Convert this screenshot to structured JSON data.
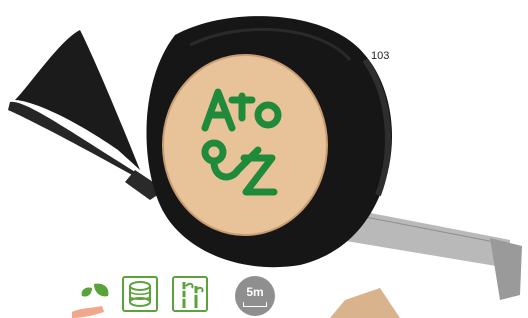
{
  "product": {
    "code": "103",
    "logo_text": "AtoZ",
    "icons": [
      {
        "name": "hand-leaf-icon"
      },
      {
        "name": "recycled-spool-icon"
      },
      {
        "name": "bamboo-icon"
      },
      {
        "name": "tape-length-icon",
        "label": "5m"
      }
    ]
  },
  "colors": {
    "case": "#161616",
    "face": "#e8c39a",
    "logo": "#1f8a3a",
    "icon_green": "#5aa33a",
    "badge_grey": "#8f8f8f"
  }
}
